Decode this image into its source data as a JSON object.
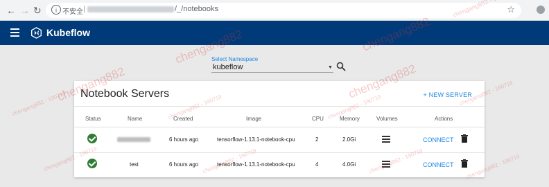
{
  "browser": {
    "insecure_label": "不安全",
    "separator": "|",
    "url_suffix": "/_/notebooks"
  },
  "app": {
    "title": "Kubeflow",
    "header_color": "#003a78",
    "accent_color": "#1e88e5",
    "success_color": "#2e7d32"
  },
  "namespace": {
    "label": "Select Namespace",
    "value": "kubeflow"
  },
  "card": {
    "title": "Notebook Servers",
    "new_server_label": "+ NEW SERVER",
    "columns": {
      "status": "Status",
      "name": "Name",
      "created": "Created",
      "image": "Image",
      "cpu": "CPU",
      "memory": "Memory",
      "volumes": "Volumes",
      "actions": "Actions"
    },
    "rows": [
      {
        "status_icon": "check-circle-icon",
        "name": "",
        "created": "6 hours ago",
        "image": "tensorflow-1.13.1-notebook-cpu",
        "cpu": "2",
        "memory": "2.0Gi",
        "connect_label": "CONNECT"
      },
      {
        "status_icon": "check-circle-icon",
        "name": "test",
        "created": "6 hours ago",
        "image": "tensorflow-1.13.1-notebook-cpu",
        "cpu": "4",
        "memory": "4.0Gi",
        "connect_label": "CONNECT"
      }
    ]
  },
  "watermark": {
    "large": "chengang882",
    "small": "chengang882 - 190719"
  }
}
